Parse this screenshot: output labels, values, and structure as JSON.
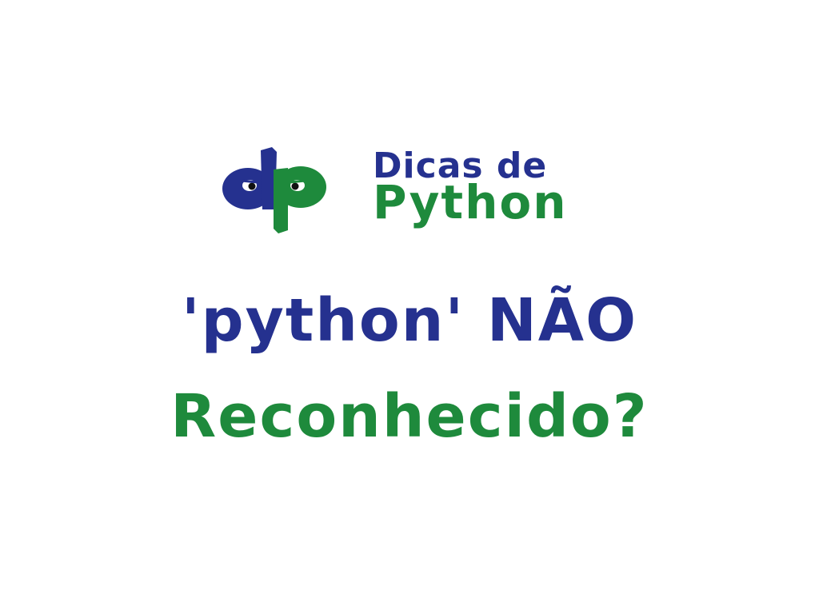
{
  "colors": {
    "blue": "#25318f",
    "green": "#1e8a3c",
    "background": "#ffffff",
    "eye_white": "#ffffff",
    "eye_pupil": "#111111"
  },
  "logo": {
    "mark_icon": "dp-monogram-with-eyes",
    "brand_line1": "Dicas de",
    "brand_line2": "Python"
  },
  "headline": {
    "line1": "'python' NÃO",
    "line2": "Reconhecido?"
  }
}
